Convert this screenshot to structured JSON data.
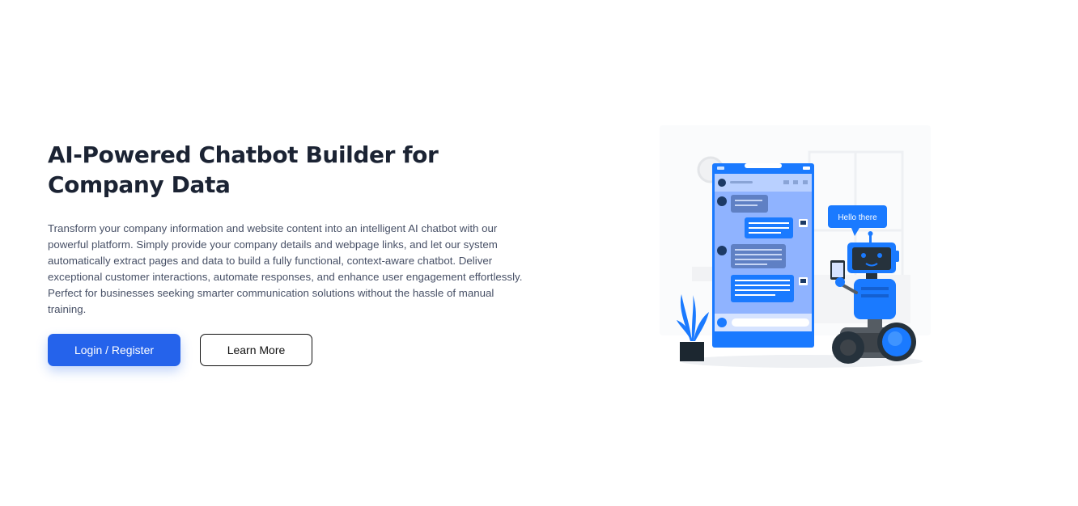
{
  "hero": {
    "title": "AI-Powered Chatbot Builder for Company Data",
    "description": "Transform your company information and website content into an intelligent AI chatbot with our powerful platform. Simply provide your company details and webpage links, and let our system automatically extract pages and data to build a fully functional, context-aware chatbot. Deliver exceptional customer interactions, automate responses, and enhance user engagement effortlessly. Perfect for businesses seeking smarter communication solutions without the hassle of manual training."
  },
  "actions": {
    "primary_label": "Login / Register",
    "secondary_label": "Learn More"
  },
  "illustration": {
    "speech_bubble": "Hello there",
    "colors": {
      "accent": "#1a7aff",
      "accent_light": "#8fb3ff",
      "robot_dark": "#26323c",
      "primary_button": "#2563eb"
    }
  }
}
